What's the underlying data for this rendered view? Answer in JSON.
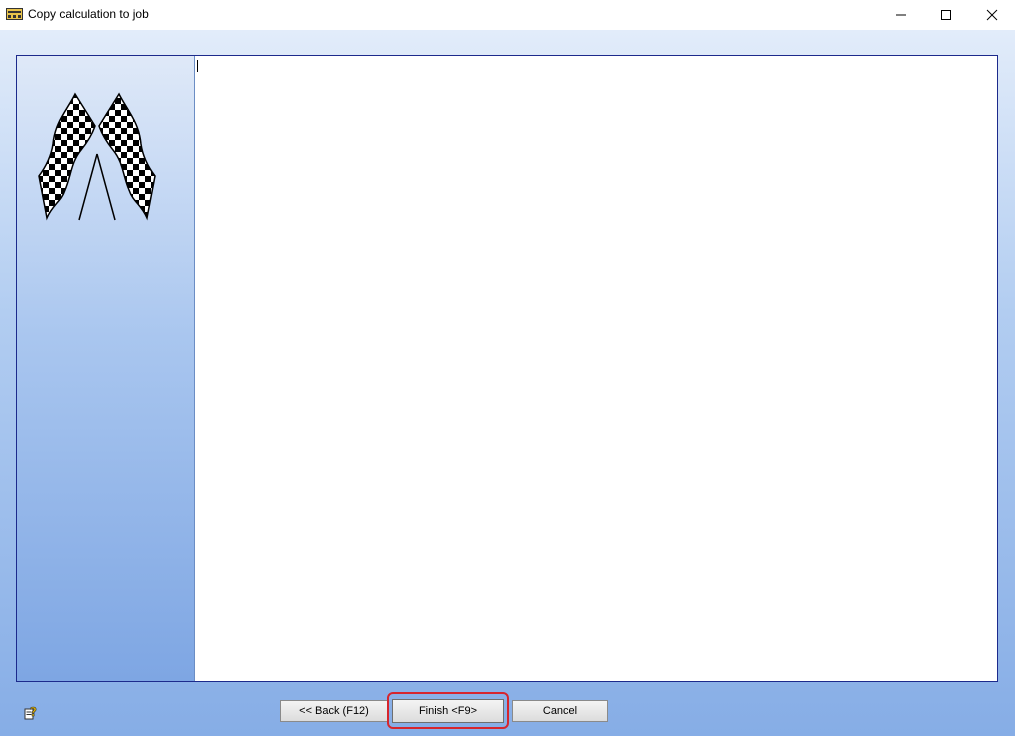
{
  "window": {
    "title": "Copy calculation to job",
    "controls": {
      "minimize": "minimize-icon",
      "maximize": "maximize-icon",
      "close": "close-icon"
    }
  },
  "side_panel": {
    "image": "checkered-flags-icon"
  },
  "text_area": {
    "value": ""
  },
  "buttons": {
    "back_label": "<< Back (F12)",
    "finish_label": "Finish <F9>",
    "cancel_label": "Cancel"
  },
  "help": {
    "icon": "help-icon"
  },
  "colors": {
    "frame_border": "#1c2a8c",
    "highlight": "#d6252d"
  }
}
